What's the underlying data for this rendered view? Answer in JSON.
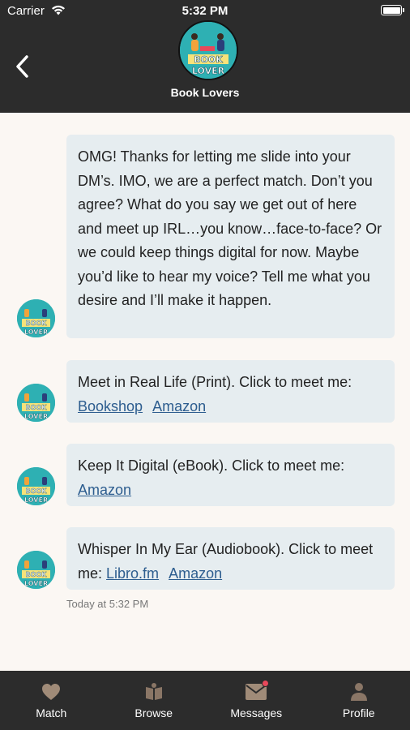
{
  "status_bar": {
    "carrier": "Carrier",
    "time": "5:32 PM"
  },
  "header": {
    "title": "Book Lovers",
    "avatar_text_top": "BOOK",
    "avatar_text_bottom": "LOVER"
  },
  "messages": [
    {
      "text": "OMG! Thanks for letting me slide into your DM’s. IMO, we are a perfect match. Don’t you agree? What do you say we get out of here and meet up IRL…you know…face-to-face? Or we could keep things digital for now. Maybe you’d like to hear my voice? Tell me what you desire and I’ll make it happen.",
      "links": []
    },
    {
      "text": "Meet in Real Life (Print). Click to meet me:",
      "links": [
        "Bookshop",
        "Amazon"
      ]
    },
    {
      "text": "Keep It Digital (eBook). Click to meet me:",
      "links": [
        "Amazon"
      ]
    },
    {
      "text": "Whisper In My Ear (Audiobook). Click to meet me:",
      "links": [
        "Libro.fm",
        "Amazon"
      ]
    }
  ],
  "timestamp": "Today at 5:32 PM",
  "tabs": [
    {
      "label": "Match",
      "icon": "heart-icon"
    },
    {
      "label": "Browse",
      "icon": "book-icon"
    },
    {
      "label": "Messages",
      "icon": "envelope-icon",
      "has_badge": true
    },
    {
      "label": "Profile",
      "icon": "person-icon"
    }
  ],
  "colors": {
    "header_bg": "#2c2c2c",
    "page_bg": "#fbf7f3",
    "bubble_bg": "#e6edf0",
    "link": "#2d5d8f",
    "badge": "#e8485a",
    "tab_icon": "#a08b78"
  }
}
